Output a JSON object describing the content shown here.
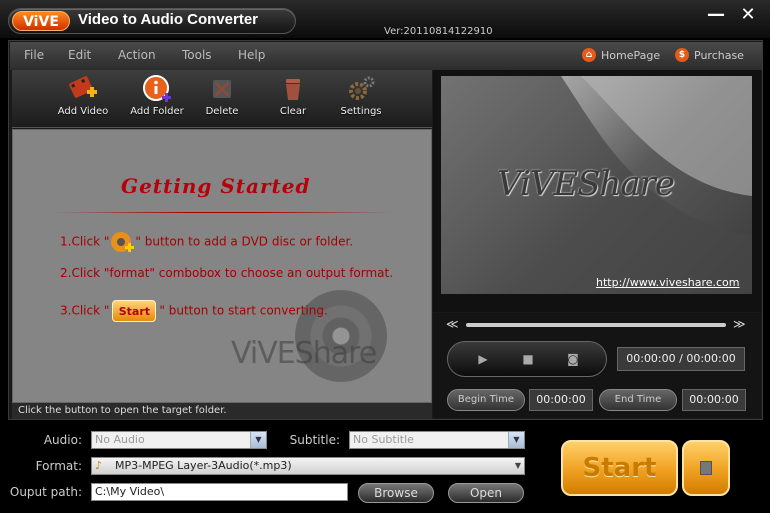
{
  "window": {
    "logo": "ViVE",
    "title": "Video to Audio Converter",
    "version": "Ver:20110814122910",
    "minimize": "—",
    "close": "✕"
  },
  "menu": {
    "items": [
      "File",
      "Edit",
      "Action",
      "Tools",
      "Help"
    ],
    "homepage": "HomePage",
    "purchase": "Purchase"
  },
  "toolbar": {
    "add_video": "Add Video",
    "add_folder": "Add Folder",
    "delete": "Delete",
    "clear": "Clear",
    "settings": "Settings"
  },
  "getting_started": {
    "title": "Getting  Started",
    "step1_pre": "1.Click \"",
    "step1_post": "\" button to add a DVD disc or folder.",
    "step2": "2.Click \"format\" combobox to choose an output format.",
    "step3_pre": "3.Click \"",
    "step3_button": "Start",
    "step3_post": "\" button to start converting.",
    "watermark": "ViVEShare"
  },
  "status": "Click the button to open the target folder.",
  "preview": {
    "brand": "ViVEShare",
    "url": "http://www.viveshare.com"
  },
  "player": {
    "rewind": "≪",
    "forward": "≫",
    "time_display": "00:00:00 / 00:00:00",
    "begin_time_label": "Begin Time",
    "begin_time_value": "00:00:00",
    "end_time_label": "End Time",
    "end_time_value": "00:00:00"
  },
  "settings_area": {
    "audio_label": "Audio:",
    "audio_value": "No Audio",
    "subtitle_label": "Subtitle:",
    "subtitle_value": "No Subtitle",
    "format_label": "Format:",
    "format_value": "MP3-MPEG Layer-3Audio(*.mp3)",
    "output_label": "Ouput path:",
    "output_value": "C:\\My Video\\",
    "browse": "Browse",
    "open": "Open",
    "start": "Start"
  },
  "colors": {
    "accent_orange": "#f0a020",
    "instruction_red": "#a80000"
  }
}
